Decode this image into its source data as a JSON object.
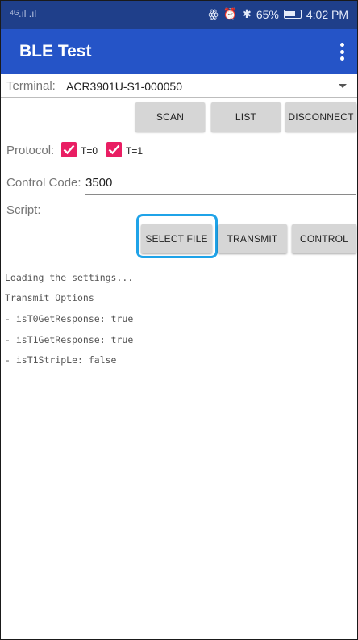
{
  "status_bar": {
    "signal_left": "⁴ᴳ.ıl  .ıl",
    "battery_percent": "65%",
    "time": "4:02 PM"
  },
  "app_bar": {
    "title": "BLE Test"
  },
  "terminal": {
    "label": "Terminal:",
    "value": "ACR3901U-S1-000050"
  },
  "buttons": {
    "scan": "SCAN",
    "list": "LIST",
    "disconnect": "DISCONNECT",
    "select_file": "SELECT FILE",
    "transmit": "TRANSMIT",
    "control": "CONTROL"
  },
  "protocol": {
    "label": "Protocol:",
    "t0_label": "T=0",
    "t1_label": "T=1",
    "t0_checked": true,
    "t1_checked": true
  },
  "control_code": {
    "label": "Control Code:",
    "value": "3500"
  },
  "script": {
    "label": "Script:"
  },
  "log_lines": [
    "Loading the settings...",
    "Transmit Options",
    "- isT0GetResponse: true",
    "- isT1GetResponse: true",
    "- isT1StripLe: false"
  ],
  "colors": {
    "status_bar": "#1f3f8a",
    "app_bar": "#2554c7",
    "checkbox": "#e91e63",
    "highlight": "#1fa3e8"
  }
}
